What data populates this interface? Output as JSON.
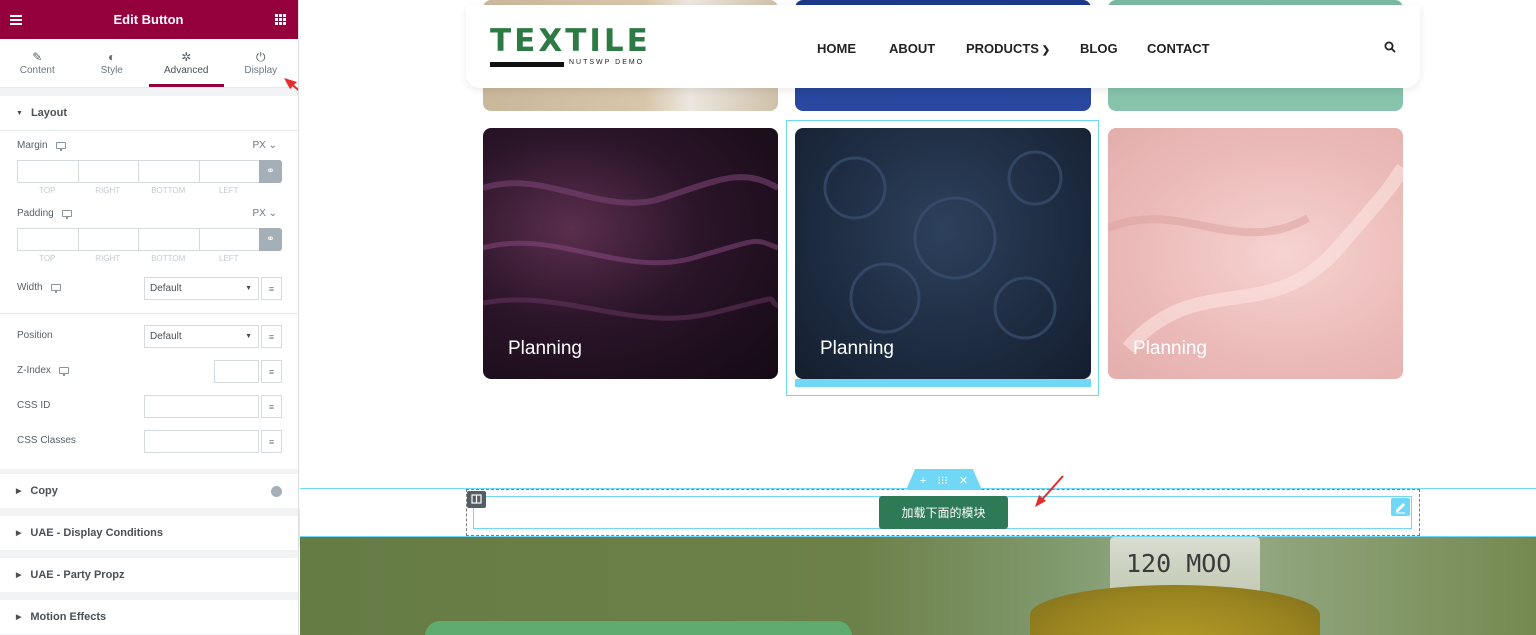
{
  "panel": {
    "title": "Edit Button",
    "tabs": [
      {
        "label": "Content",
        "icon": "pencil-icon"
      },
      {
        "label": "Style",
        "icon": "contrast-icon"
      },
      {
        "label": "Advanced",
        "icon": "gear-icon",
        "active": true
      },
      {
        "label": "Display",
        "icon": "power-icon"
      }
    ],
    "layout": {
      "title": "Layout",
      "margin_label": "Margin",
      "padding_label": "Padding",
      "unit": "PX",
      "dim_labels": [
        "TOP",
        "RIGHT",
        "BOTTOM",
        "LEFT"
      ],
      "width_label": "Width",
      "width_value": "Default",
      "position_label": "Position",
      "position_value": "Default",
      "zindex_label": "Z-Index",
      "cssid_label": "CSS ID",
      "cssclasses_label": "CSS Classes"
    },
    "sections": [
      "Copy",
      "UAE - Display Conditions",
      "UAE - Party Propz",
      "Motion Effects"
    ]
  },
  "site": {
    "logo": "TEXTILE",
    "logo_tagline": "NUTSWP DEMO",
    "nav": [
      "HOME",
      "ABOUT",
      "PRODUCTS",
      "BLOG",
      "CONTACT"
    ],
    "cards": [
      "Planning",
      "Planning",
      "Planning"
    ],
    "load_button": "加载下面的模块",
    "spool_text": "120 MOO"
  },
  "colors": {
    "panel_accent": "#93003c",
    "brand_green": "#2e7a45",
    "editor_blue": "#71d7f7"
  }
}
